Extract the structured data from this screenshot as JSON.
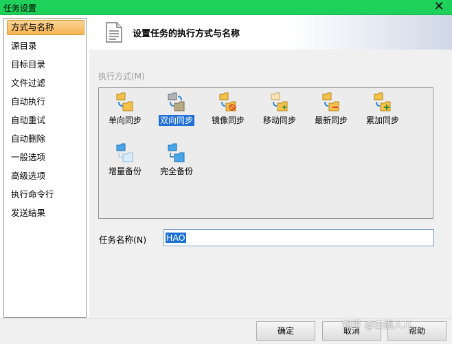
{
  "window": {
    "title": "任务设置",
    "close_label": "✕"
  },
  "sidebar": {
    "items": [
      {
        "label": "方式与名称",
        "selected": true
      },
      {
        "label": "源目录"
      },
      {
        "label": "目标目录"
      },
      {
        "label": "文件过滤"
      },
      {
        "label": "自动执行"
      },
      {
        "label": "自动重试"
      },
      {
        "label": "自动删除"
      },
      {
        "label": "一般选项"
      },
      {
        "label": "高级选项"
      },
      {
        "label": "执行命令行"
      },
      {
        "label": "发送结果"
      }
    ]
  },
  "header": {
    "title": "设置任务的执行方式与名称"
  },
  "methods": {
    "label": "执行方式(M)",
    "items": [
      {
        "label": "单向同步",
        "icon": "one-way-sync-icon"
      },
      {
        "label": "双向同步",
        "icon": "two-way-sync-icon",
        "selected": true
      },
      {
        "label": "镜像同步",
        "icon": "mirror-sync-icon"
      },
      {
        "label": "移动同步",
        "icon": "move-sync-icon"
      },
      {
        "label": "最新同步",
        "icon": "latest-sync-icon"
      },
      {
        "label": "累加同步",
        "icon": "cumulative-sync-icon"
      },
      {
        "label": "增量备份",
        "icon": "incremental-backup-icon"
      },
      {
        "label": "完全备份",
        "icon": "full-backup-icon"
      }
    ]
  },
  "task_name": {
    "label": "任务名称(N)",
    "value": "HAO"
  },
  "footer": {
    "ok_label": "确定",
    "cancel_label": "取消",
    "help_label": "帮助"
  },
  "watermark": "知乎 @白面人儿",
  "colors": {
    "titlebar": "#1ed15a",
    "selection": "#1e6fd6",
    "sidebar_selected": "#f5b452"
  }
}
